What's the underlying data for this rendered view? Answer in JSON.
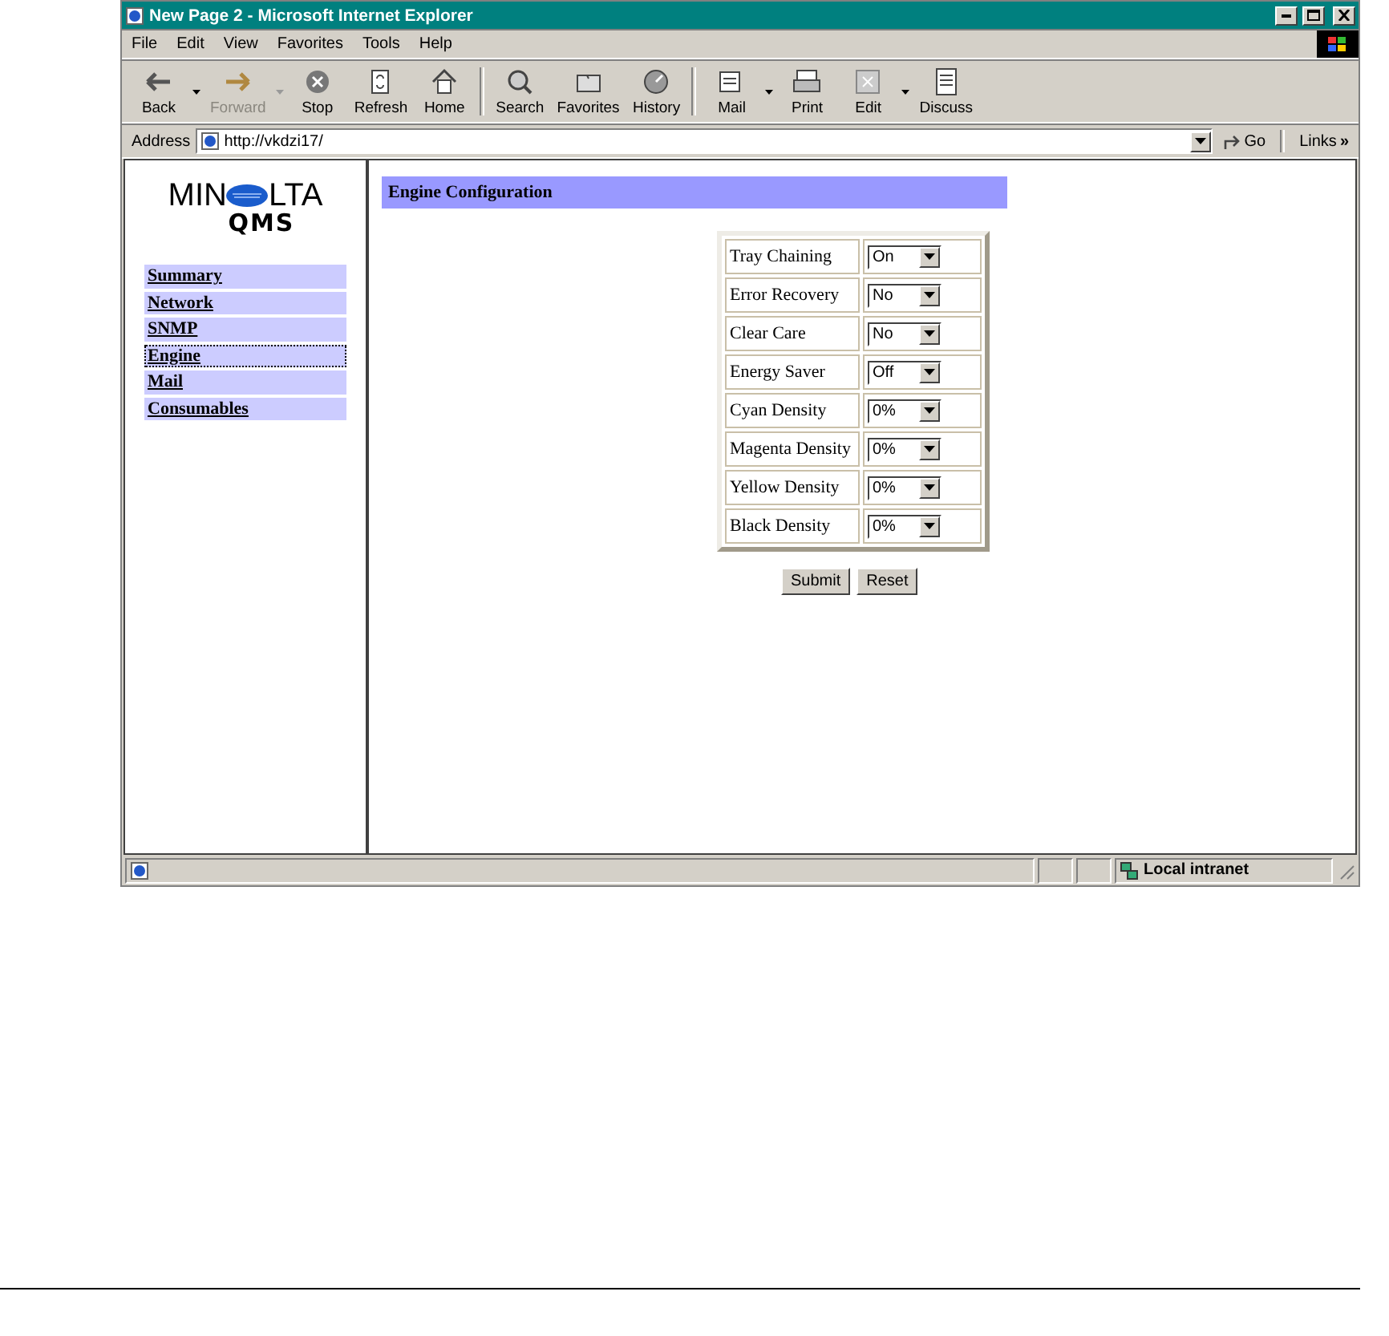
{
  "window": {
    "title": "New Page 2 - Microsoft Internet Explorer"
  },
  "menu": [
    "File",
    "Edit",
    "View",
    "Favorites",
    "Tools",
    "Help"
  ],
  "toolbar": [
    {
      "label": "Back",
      "kind": "back",
      "disabled": false,
      "dropdown": true
    },
    {
      "label": "Forward",
      "kind": "forward",
      "disabled": true,
      "dropdown": true
    },
    {
      "label": "Stop",
      "kind": "stop",
      "disabled": false,
      "dropdown": false
    },
    {
      "label": "Refresh",
      "kind": "refresh",
      "disabled": false,
      "dropdown": false
    },
    {
      "label": "Home",
      "kind": "home",
      "disabled": false,
      "dropdown": false,
      "separator_after": true
    },
    {
      "label": "Search",
      "kind": "search",
      "disabled": false,
      "dropdown": false
    },
    {
      "label": "Favorites",
      "kind": "favorites",
      "disabled": false,
      "dropdown": false
    },
    {
      "label": "History",
      "kind": "history",
      "disabled": false,
      "dropdown": false,
      "separator_after": true
    },
    {
      "label": "Mail",
      "kind": "mail",
      "disabled": false,
      "dropdown": true
    },
    {
      "label": "Print",
      "kind": "print",
      "disabled": false,
      "dropdown": false
    },
    {
      "label": "Edit",
      "kind": "edit",
      "disabled": false,
      "dropdown": true
    },
    {
      "label": "Discuss",
      "kind": "discuss",
      "disabled": false,
      "dropdown": false
    }
  ],
  "address_bar": {
    "label": "Address",
    "value": "http://vkdzi17/",
    "go": "Go",
    "links": "Links",
    "links_more": "»"
  },
  "logo": {
    "left": "MIN",
    "right": "LTA",
    "sub": "QMS"
  },
  "nav": [
    {
      "label": "Summary",
      "selected": false
    },
    {
      "label": "Network",
      "selected": false
    },
    {
      "label": "SNMP",
      "selected": false
    },
    {
      "label": "Engine",
      "selected": true
    },
    {
      "label": "Mail",
      "selected": false
    },
    {
      "label": "Consumables",
      "selected": false
    }
  ],
  "heading": "Engine Configuration",
  "settings": [
    {
      "label": "Tray Chaining",
      "value": "On"
    },
    {
      "label": "Error Recovery",
      "value": "No"
    },
    {
      "label": "Clear Care",
      "value": "No"
    },
    {
      "label": "Energy Saver",
      "value": "Off"
    },
    {
      "label": "Cyan Density",
      "value": "0%"
    },
    {
      "label": "Magenta Density",
      "value": "0%"
    },
    {
      "label": "Yellow Density",
      "value": "0%"
    },
    {
      "label": "Black Density",
      "value": "0%"
    }
  ],
  "buttons": [
    "Submit",
    "Reset"
  ],
  "status_bar": {
    "zone": "Local intranet"
  }
}
